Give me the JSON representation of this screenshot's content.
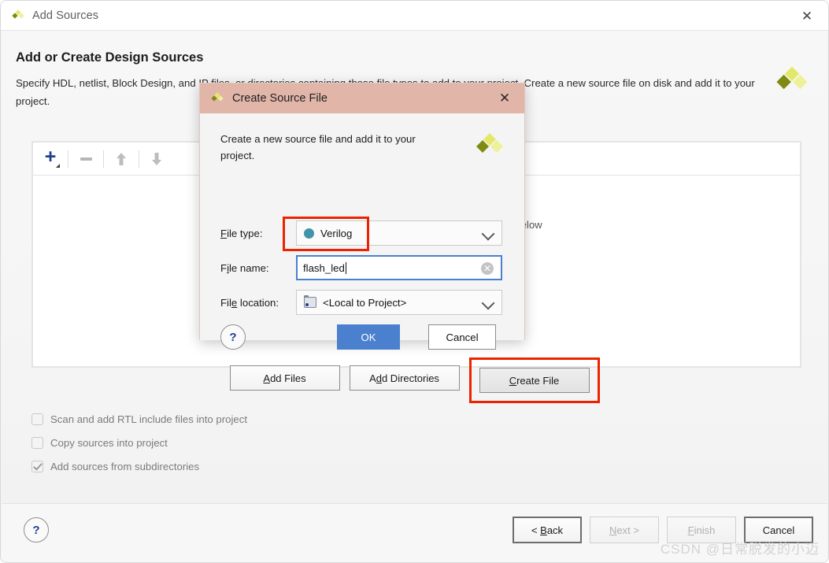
{
  "window": {
    "title": "Add Sources",
    "icon": "xilinx-logo-icon",
    "close_label": "✕"
  },
  "page": {
    "heading": "Add or Create Design Sources",
    "description": "Specify HDL, netlist, Block Design, and IP files, or directories containing those file types to add to your project. Create a new source file on disk and add it to your project.",
    "brand_icon": "xilinx-logo-icon"
  },
  "list_panel": {
    "toolbar": {
      "add_label": "+",
      "remove_label": "−",
      "move_up_label": "↑",
      "move_down_label": "↓"
    },
    "empty_hint": "Use Add Files, Add Directories or Create File buttons below"
  },
  "actions": {
    "add_files": "Add Files",
    "add_directories": "Add Directories",
    "create_file": "Create File",
    "highlight_color": "#ee2200"
  },
  "checkboxes": [
    {
      "label": "Scan and add RTL include files into project",
      "checked": false
    },
    {
      "label": "Copy sources into project",
      "checked": false
    },
    {
      "label": "Add sources from subdirectories",
      "checked": true
    }
  ],
  "footer": {
    "help_label": "?",
    "back": "< Back",
    "next": "Next >",
    "finish": "Finish",
    "cancel": "Cancel"
  },
  "watermark": "CSDN @日常脱发的小迈",
  "modal": {
    "title": "Create Source File",
    "icon": "xilinx-logo-icon",
    "close_label": "✕",
    "description": "Create a new source file and add it to your project.",
    "brand_icon": "xilinx-logo-icon",
    "fields": {
      "file_type_label": "File type:",
      "file_type_value": "Verilog",
      "file_type_dot_color": "#4193a8",
      "file_name_label": "File name:",
      "file_name_value": "flash_led",
      "file_name_placeholder": "",
      "file_location_label": "File location:",
      "file_location_value": "<Local to Project>"
    },
    "help_label": "?",
    "ok_label": "OK",
    "cancel_label": "Cancel",
    "ok_color": "#4a80cd",
    "titlebar_color": "#e2b5a9"
  }
}
